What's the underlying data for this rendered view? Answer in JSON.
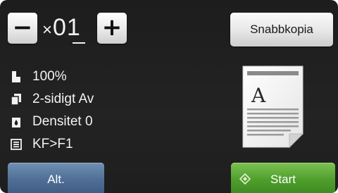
{
  "copies": {
    "minus_glyph": "−",
    "plus_glyph": "+",
    "prefix": "×",
    "value": "01"
  },
  "quick_copy_label": "Snabbkopia",
  "settings": [
    {
      "icon": "page-icon",
      "label": "100%"
    },
    {
      "icon": "duplex-pages-icon",
      "label": "2-sidigt Av"
    },
    {
      "icon": "density-drop-icon",
      "label": "Densitet 0"
    },
    {
      "icon": "list-icon",
      "label": "KF>F1"
    }
  ],
  "preview": {
    "icon": "document-preview-icon",
    "letter": "A"
  },
  "buttons": {
    "alt_label": "Alt.",
    "start_label": "Start"
  },
  "colors": {
    "alt_button": "#4f6f96",
    "start_button": "#4f9f2c",
    "background": "#1f1f1f"
  }
}
